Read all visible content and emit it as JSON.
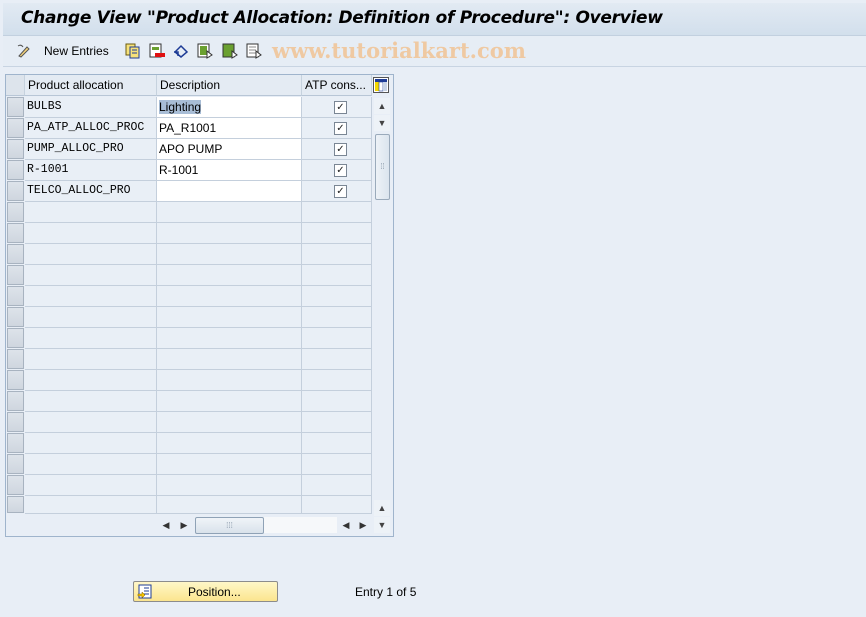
{
  "window": {
    "title": "Change View \"Product Allocation: Definition of Procedure\": Overview"
  },
  "toolbar": {
    "items": [
      {
        "icon": "edit-pencil-icon",
        "label": ""
      },
      {
        "icon": "",
        "label": "New Entries"
      },
      {
        "icon": "copy-as-icon",
        "label": ""
      },
      {
        "icon": "delete-icon",
        "label": ""
      },
      {
        "icon": "undo-change-icon",
        "label": ""
      },
      {
        "icon": "select-all-icon",
        "label": ""
      },
      {
        "icon": "select-block-icon",
        "label": ""
      },
      {
        "icon": "deselect-all-icon",
        "label": ""
      }
    ],
    "watermark": "www.tutorialkart.com"
  },
  "table": {
    "columns": [
      "Product allocation",
      "Description",
      "ATP cons..."
    ],
    "rows": [
      {
        "product_allocation": "BULBS",
        "description": "Lighting",
        "atp_cons": true
      },
      {
        "product_allocation": "PA_ATP_ALLOC_PROC",
        "description": "PA_R1001",
        "atp_cons": true
      },
      {
        "product_allocation": "PUMP_ALLOC_PRO",
        "description": "APO PUMP",
        "atp_cons": true
      },
      {
        "product_allocation": "R-1001",
        "description": "R-1001",
        "atp_cons": true
      },
      {
        "product_allocation": "TELCO_ALLOC_PRO",
        "description": "",
        "atp_cons": true
      }
    ],
    "check_glyph": "✓"
  },
  "footer": {
    "position_button": "Position...",
    "entry_text": "Entry 1 of 5"
  }
}
